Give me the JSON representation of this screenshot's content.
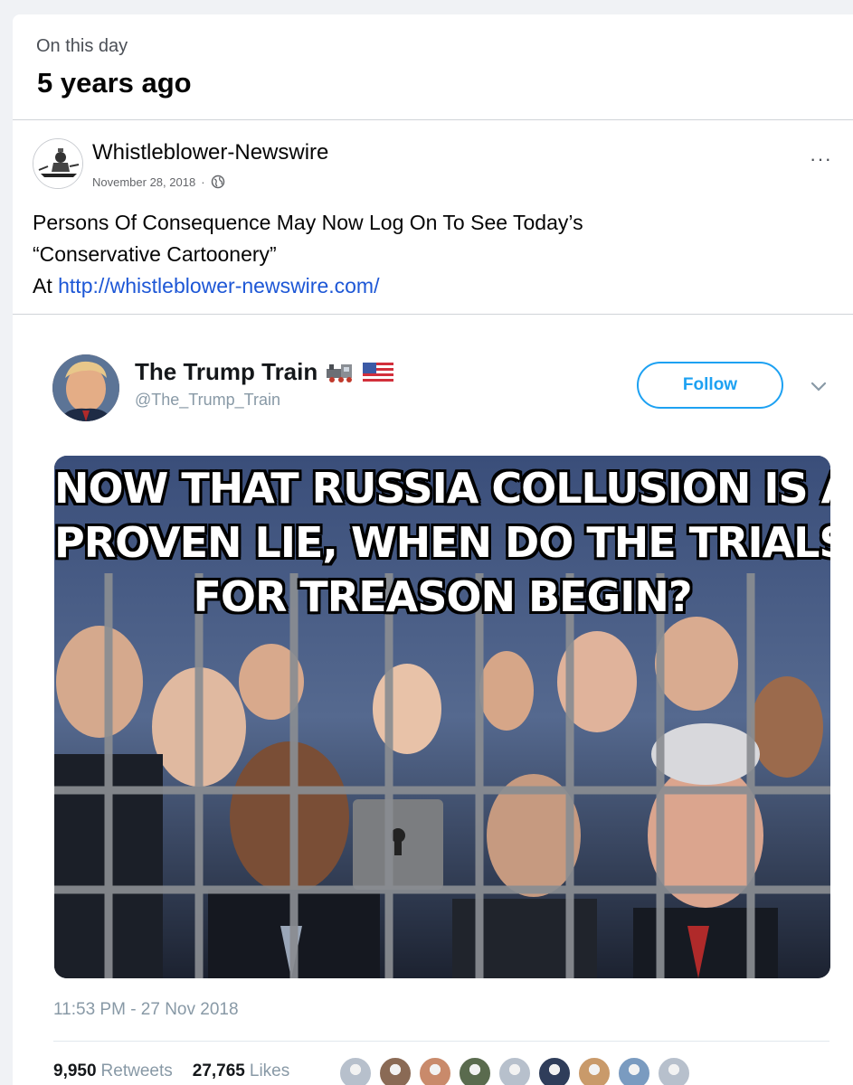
{
  "memory": {
    "label": "On this day",
    "title": "5 years ago"
  },
  "post": {
    "page_name": "Whistleblower-Newswire",
    "date": "November 28, 2018",
    "separator": "·",
    "privacy_icon": "globe-icon",
    "more_label": "···",
    "text_line1": "Persons Of Consequence May Now Log On To See Today’s",
    "text_line2": "“Conservative Cartoonery”",
    "text_line3_prefix": "At ",
    "link": "http://whistleblower-newswire.com/"
  },
  "tweet": {
    "name": "The Trump Train",
    "name_emojis": [
      "train-emoji",
      "us-flag-emoji"
    ],
    "handle": "@The_Trump_Train",
    "follow_label": "Follow",
    "meme_line1": "NOW THAT RUSSIA COLLUSION IS A",
    "meme_line2": "PROVEN LIE, WHEN DO THE TRIALS",
    "meme_line3": "FOR TREASON BEGIN?",
    "timestamp": "11:53 PM - 27 Nov 2018",
    "retweets_count": "9,950",
    "retweets_label": "Retweets",
    "likes_count": "27,765",
    "likes_label": "Likes",
    "liker_colors": [
      "#b7c0cc",
      "#8a6a55",
      "#c98a6b",
      "#5a6b4e",
      "#b7c0cc",
      "#2f3d5a",
      "#c99a6a",
      "#7a9bc0",
      "#b7c0cc"
    ]
  },
  "colors": {
    "accent": "#1da1f2",
    "link": "#1d57d6",
    "muted": "#8899a6"
  }
}
